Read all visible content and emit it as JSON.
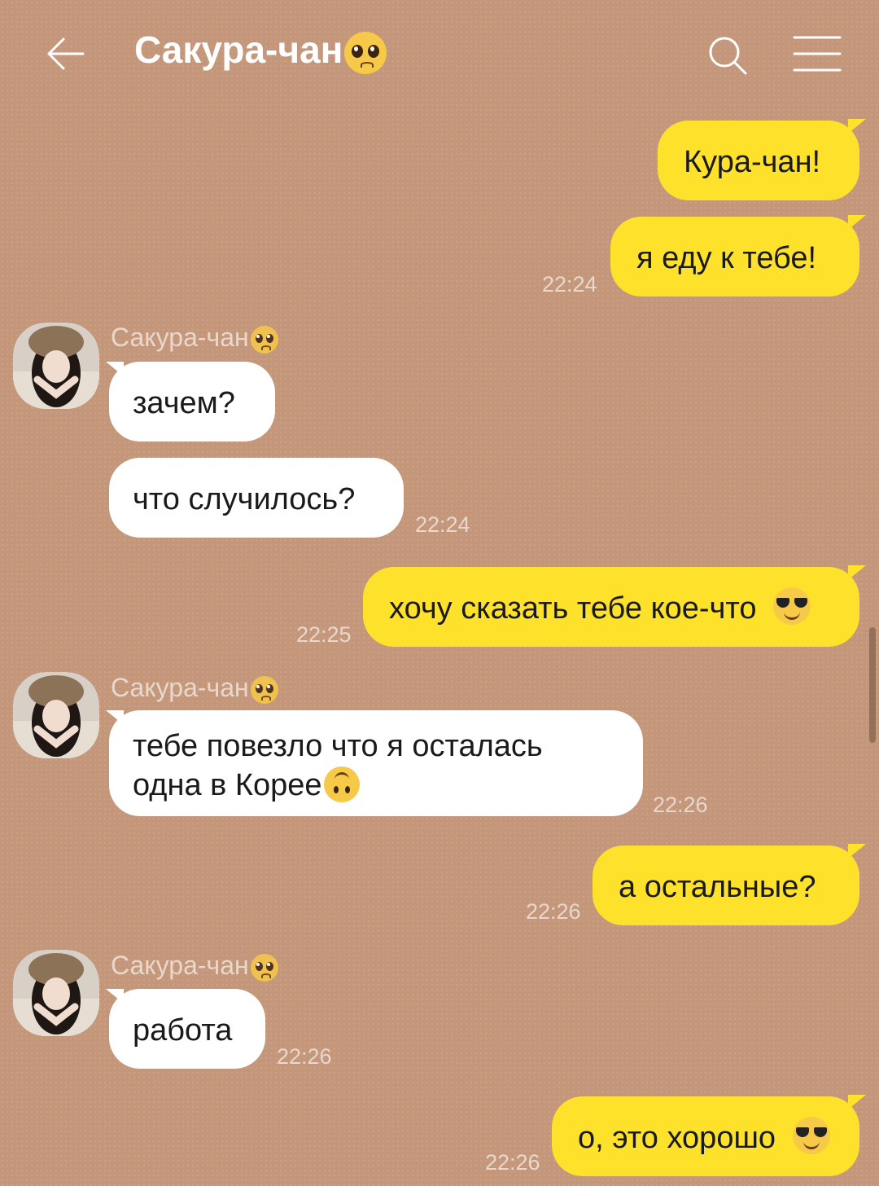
{
  "header": {
    "title": "Сакура-чан",
    "back_icon": "arrow-left-icon",
    "search_icon": "search-icon",
    "menu_icon": "hamburger-menu-icon"
  },
  "contact_name": "Сакура-чан",
  "colors": {
    "outgoing": "#fde12b",
    "incoming": "#ffffff",
    "background": "#c4977a"
  },
  "messages": [
    {
      "dir": "out",
      "text": "Кура-чан!",
      "time": ""
    },
    {
      "dir": "out",
      "text": "я еду к тебе!",
      "time": "22:24"
    },
    {
      "dir": "in",
      "sender": "Сакура-чан",
      "text": "зачем?",
      "time": ""
    },
    {
      "dir": "in",
      "text": "что случилось?",
      "time": "22:24"
    },
    {
      "dir": "out",
      "text": "хочу сказать тебе кое-что",
      "emoji": "sunglasses-emoji",
      "time": "22:25"
    },
    {
      "dir": "in",
      "sender": "Сакура-чан",
      "text_line1": "тебе повезло что я осталась",
      "text_line2": "одна в Корее",
      "emoji": "upside-down-face-emoji",
      "time": "22:26"
    },
    {
      "dir": "out",
      "text": "а остальные?",
      "time": "22:26"
    },
    {
      "dir": "in",
      "sender": "Сакура-чан",
      "text": "работа",
      "time": "22:26"
    },
    {
      "dir": "out",
      "text": "о, это хорошо",
      "emoji": "sunglasses-emoji",
      "time": "22:26"
    }
  ]
}
